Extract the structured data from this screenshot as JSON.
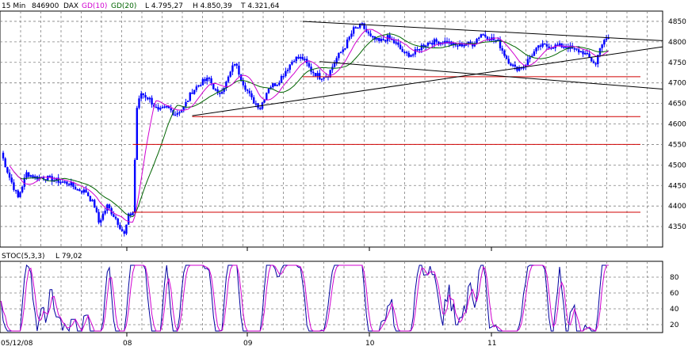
{
  "header": {
    "interval": "15 Min",
    "symbol_id": "846900",
    "symbol": "DAX",
    "ma1_label": "GD(10)",
    "ma2_label": "GD(20)",
    "low": "L  4.795,27",
    "high": "H  4.850,39",
    "other": "T  4.321,64"
  },
  "stoch_header": {
    "label": "STOC(5,3,3)",
    "value": "L  79,02"
  },
  "colors": {
    "candle": "#0000ff",
    "ma1": "#d000d0",
    "ma2": "#006400",
    "trend": "#000000",
    "support": "#d00000",
    "stoch_k": "#0000a0",
    "stoch_d": "#d000d0"
  },
  "chart_data": [
    {
      "type": "candlestick",
      "title": "",
      "ylim": [
        4300,
        4875
      ],
      "y_ticks": [
        4350,
        4400,
        4450,
        4500,
        4550,
        4600,
        4650,
        4700,
        4750,
        4800,
        4850
      ],
      "x_tick_labels": [
        "05/12/08",
        "08",
        "09",
        "10",
        "11"
      ],
      "grid": true,
      "series": [
        {
          "name": "DAX 846900",
          "close_path": [
            [
              0,
              4530
            ],
            [
              4,
              4470
            ],
            [
              8,
              4420
            ],
            [
              12,
              4480
            ],
            [
              16,
              4470
            ],
            [
              20,
              4470
            ],
            [
              24,
              4465
            ],
            [
              28,
              4460
            ],
            [
              32,
              4455
            ],
            [
              36,
              4440
            ],
            [
              40,
              4435
            ],
            [
              44,
              4400
            ],
            [
              46,
              4360
            ],
            [
              50,
              4400
            ],
            [
              54,
              4370
            ],
            [
              56,
              4350
            ],
            [
              58,
              4330
            ],
            [
              60,
              4375
            ],
            [
              62,
              4385
            ],
            [
              64,
              4640
            ],
            [
              66,
              4675
            ],
            [
              70,
              4660
            ],
            [
              74,
              4630
            ],
            [
              78,
              4640
            ],
            [
              82,
              4625
            ],
            [
              86,
              4640
            ],
            [
              90,
              4680
            ],
            [
              94,
              4700
            ],
            [
              98,
              4710
            ],
            [
              102,
              4670
            ],
            [
              106,
              4700
            ],
            [
              110,
              4750
            ],
            [
              114,
              4700
            ],
            [
              118,
              4660
            ],
            [
              122,
              4640
            ],
            [
              126,
              4690
            ],
            [
              130,
              4700
            ],
            [
              134,
              4730
            ],
            [
              138,
              4760
            ],
            [
              142,
              4760
            ],
            [
              146,
              4730
            ],
            [
              150,
              4715
            ],
            [
              154,
              4720
            ],
            [
              158,
              4760
            ],
            [
              162,
              4790
            ],
            [
              166,
              4830
            ],
            [
              170,
              4840
            ],
            [
              174,
              4810
            ],
            [
              178,
              4800
            ],
            [
              182,
              4810
            ],
            [
              186,
              4795
            ],
            [
              190,
              4770
            ],
            [
              194,
              4770
            ],
            [
              198,
              4790
            ],
            [
              202,
              4800
            ],
            [
              206,
              4800
            ],
            [
              210,
              4800
            ],
            [
              214,
              4790
            ],
            [
              218,
              4795
            ],
            [
              222,
              4795
            ],
            [
              226,
              4820
            ],
            [
              230,
              4810
            ],
            [
              234,
              4800
            ],
            [
              238,
              4760
            ],
            [
              242,
              4735
            ],
            [
              246,
              4740
            ],
            [
              250,
              4770
            ],
            [
              254,
              4790
            ],
            [
              258,
              4790
            ],
            [
              262,
              4790
            ],
            [
              266,
              4790
            ],
            [
              270,
              4780
            ],
            [
              274,
              4775
            ],
            [
              278,
              4755
            ],
            [
              280,
              4745
            ],
            [
              282,
              4790
            ],
            [
              286,
              4810
            ]
          ]
        },
        {
          "name": "GD(10)",
          "line": true
        },
        {
          "name": "GD(20)",
          "line": true
        }
      ],
      "trend_lines": [
        {
          "from": [
            142,
            4850
          ],
          "to": [
            312,
            4803
          ]
        },
        {
          "from": [
            90,
            4620
          ],
          "to": [
            312,
            4788
          ]
        },
        {
          "from": [
            150,
            4752
          ],
          "to": [
            312,
            4685
          ]
        }
      ],
      "support_lines": [
        4715,
        4618,
        4550,
        4385
      ]
    },
    {
      "type": "line",
      "title": "",
      "ylim": [
        10,
        100
      ],
      "y_ticks": [
        20,
        40,
        60,
        80
      ],
      "grid": true,
      "series": [
        {
          "name": "STOC(5,3,3) %K"
        },
        {
          "name": "STOC(5,3,3) %D"
        }
      ],
      "last_value": 79.02
    }
  ]
}
